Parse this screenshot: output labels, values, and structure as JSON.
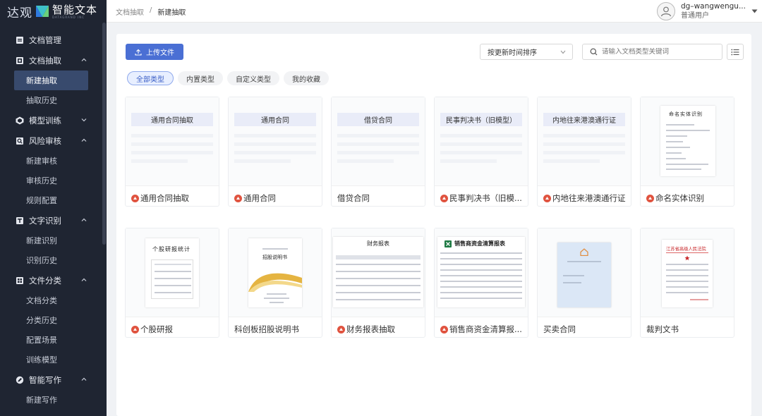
{
  "app": {
    "logo_cn": "达观",
    "logo_name": "智能文本",
    "logo_sub": "DATAGRAND INC"
  },
  "sidebar": {
    "groups": [
      {
        "label": "文档管理",
        "icon": "doc-manage-icon",
        "expanded": null,
        "items": []
      },
      {
        "label": "文档抽取",
        "icon": "doc-extract-icon",
        "expanded": true,
        "items": [
          "新建抽取",
          "抽取历史"
        ]
      },
      {
        "label": "模型训练",
        "icon": "model-train-icon",
        "expanded": false,
        "items": []
      },
      {
        "label": "风险审核",
        "icon": "risk-review-icon",
        "expanded": true,
        "items": [
          "新建审核",
          "审核历史",
          "规则配置"
        ]
      },
      {
        "label": "文字识别",
        "icon": "ocr-icon",
        "expanded": true,
        "items": [
          "新建识别",
          "识别历史"
        ]
      },
      {
        "label": "文件分类",
        "icon": "file-classify-icon",
        "expanded": true,
        "items": [
          "文档分类",
          "分类历史",
          "配置场景",
          "训练模型"
        ]
      },
      {
        "label": "智能写作",
        "icon": "smart-write-icon",
        "expanded": true,
        "items": [
          "新建写作"
        ]
      }
    ],
    "active_item": "新建抽取"
  },
  "header": {
    "breadcrumb": [
      "文档抽取",
      "新建抽取"
    ],
    "separator": "/",
    "user_name": "dg–wangwengu...",
    "user_role": "普通用户"
  },
  "toolbar": {
    "upload_label": "上传文件",
    "sort_value": "按更新时间排序",
    "search_placeholder": "请输入文档类型关键词"
  },
  "tabs": [
    {
      "label": "全部类型",
      "active": true
    },
    {
      "label": "内置类型",
      "active": false
    },
    {
      "label": "自定义类型",
      "active": false
    },
    {
      "label": "我的收藏",
      "active": false
    }
  ],
  "cards": [
    {
      "title": "通用合同抽取",
      "badge": true,
      "thumb": "template",
      "thumb_label": "通用合同抽取"
    },
    {
      "title": "通用合同",
      "badge": true,
      "thumb": "template",
      "thumb_label": "通用合同"
    },
    {
      "title": "借贷合同",
      "badge": false,
      "thumb": "template",
      "thumb_label": "借贷合同"
    },
    {
      "title": "民事判决书（旧模...",
      "badge": true,
      "thumb": "template",
      "thumb_label": "民事判决书（旧模型）"
    },
    {
      "title": "内地往来港澳通行证",
      "badge": true,
      "thumb": "template",
      "thumb_label": "内地往来港澳通行证"
    },
    {
      "title": "命名实体识别",
      "badge": true,
      "thumb": "doc",
      "thumb_label": "命名实体识别"
    },
    {
      "title": "个股研报",
      "badge": true,
      "thumb": "doc",
      "thumb_label": "个股研报统计"
    },
    {
      "title": "科创板招股说明书",
      "badge": false,
      "thumb": "doc",
      "thumb_label": "招股说明书"
    },
    {
      "title": "财务报表抽取",
      "badge": true,
      "thumb": "doc",
      "thumb_label": "财务报表"
    },
    {
      "title": "销售商资金清算报...",
      "badge": true,
      "thumb": "doc",
      "thumb_label": "销售商资金清算报表"
    },
    {
      "title": "买卖合同",
      "badge": false,
      "thumb": "doc",
      "thumb_label": ""
    },
    {
      "title": "裁判文书",
      "badge": false,
      "thumb": "doc",
      "thumb_label": "江苏省高级人民法院"
    }
  ]
}
